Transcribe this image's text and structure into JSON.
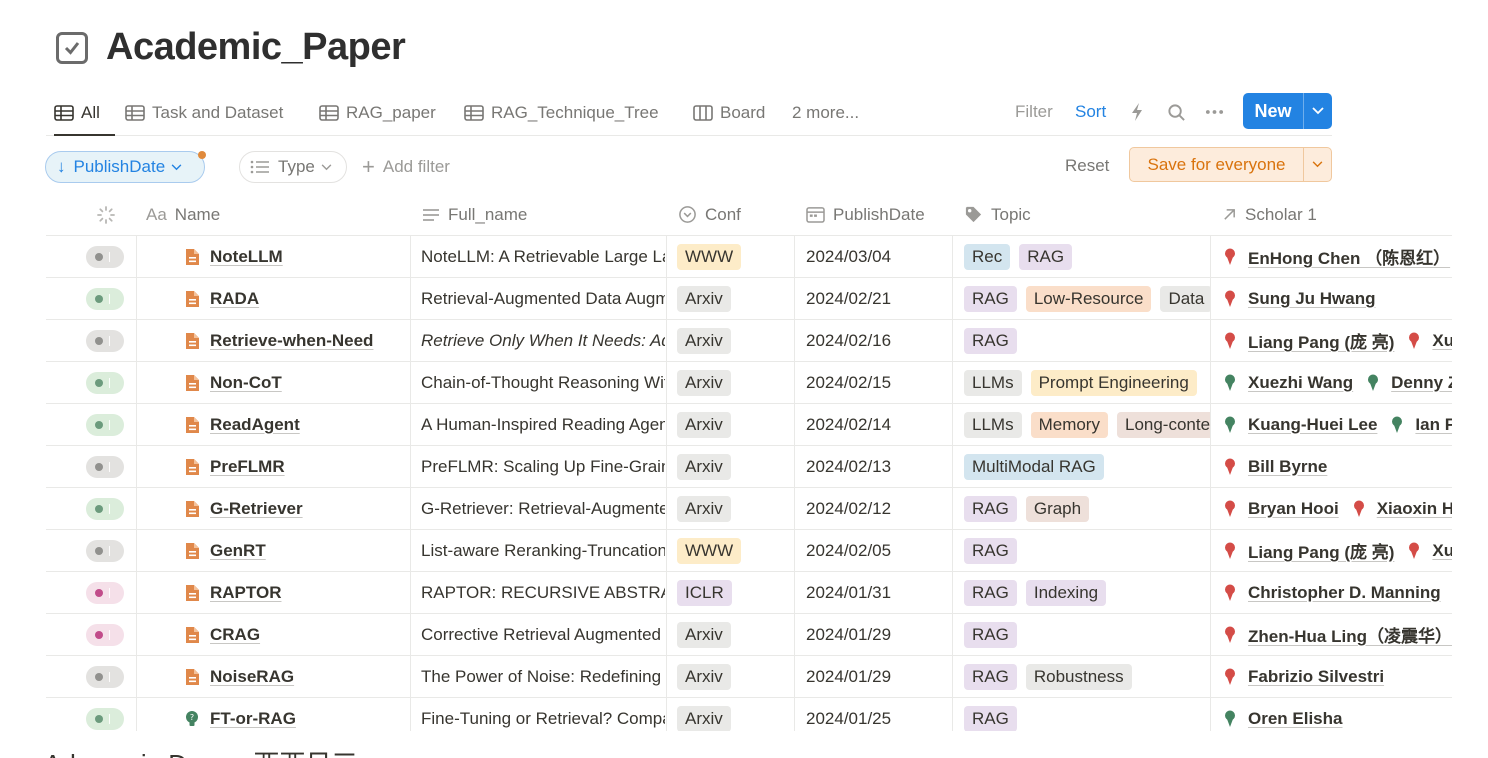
{
  "page": {
    "title": "Academic_Paper",
    "footer_fragment": "Adaomaia Damar 西西日三"
  },
  "views": {
    "tabs": [
      {
        "label": "All",
        "active": true,
        "icon": "table-icon"
      },
      {
        "label": "Task and Dataset",
        "icon": "table-icon"
      },
      {
        "label": "RAG_paper",
        "icon": "table-icon"
      },
      {
        "label": "RAG_Technique_Tree",
        "icon": "table-icon"
      },
      {
        "label": "Board",
        "icon": "board-icon"
      }
    ],
    "more_label": "2 more...",
    "filter_label": "Filter",
    "sort_label": "Sort",
    "new_label": "New"
  },
  "filters": {
    "sort_pill": "PublishDate",
    "type_pill": "Type",
    "add_filter": "Add filter",
    "reset": "Reset",
    "save": "Save for everyone"
  },
  "columns": {
    "name": "Name",
    "name_prefix": "Aa",
    "full_name": "Full_name",
    "conf": "Conf",
    "publish_date": "PublishDate",
    "topic": "Topic",
    "scholar": "Scholar 1"
  },
  "colors": {
    "accent": "#2383e2",
    "status_gray": "#e3e2e0",
    "status_green": "#dbeddb",
    "status_pink": "#f5e0e9",
    "tag_gray": "#e9e9e7",
    "tag_yellow": "#fdecc8",
    "tag_orange": "#fadec9",
    "tag_purple": "#e8deee",
    "tag_blue": "#d3e5ef",
    "tag_brown": "#eee0da",
    "pin_red": "#d44c47",
    "pin_green": "#448361"
  },
  "rows": [
    {
      "status": "gray",
      "icon": "doc",
      "name": "NoteLLM",
      "full": "NoteLLM: A Retrievable Large Language Model",
      "full_italic": false,
      "conf": {
        "label": "WWW",
        "color": "yellow"
      },
      "date": "2024/03/04",
      "topics": [
        {
          "label": "Rec",
          "color": "blue"
        },
        {
          "label": "RAG",
          "color": "purple"
        }
      ],
      "scholars": [
        {
          "name": "EnHong Chen （陈恩红）",
          "pin": "red"
        }
      ]
    },
    {
      "status": "green",
      "icon": "doc",
      "name": "RADA",
      "full": "Retrieval-Augmented Data Augmentation",
      "full_italic": false,
      "conf": {
        "label": "Arxiv",
        "color": "gray"
      },
      "date": "2024/02/21",
      "topics": [
        {
          "label": "RAG",
          "color": "purple"
        },
        {
          "label": "Low-Resource",
          "color": "orange"
        },
        {
          "label": "Data",
          "color": "gray"
        }
      ],
      "scholars": [
        {
          "name": "Sung Ju Hwang",
          "pin": "red"
        }
      ]
    },
    {
      "status": "gray",
      "icon": "doc",
      "name": "Retrieve-when-Need",
      "full": "Retrieve Only When It Needs: Adaptive Retrieval",
      "full_italic": true,
      "conf": {
        "label": "Arxiv",
        "color": "gray"
      },
      "date": "2024/02/16",
      "topics": [
        {
          "label": "RAG",
          "color": "purple"
        }
      ],
      "scholars": [
        {
          "name": "Liang Pang (庞 亮)",
          "pin": "red"
        },
        {
          "name": "Xueqi",
          "pin": "red"
        }
      ]
    },
    {
      "status": "green",
      "icon": "doc",
      "name": "Non-CoT",
      "full": "Chain-of-Thought Reasoning Without Prompting",
      "full_italic": false,
      "conf": {
        "label": "Arxiv",
        "color": "gray"
      },
      "date": "2024/02/15",
      "topics": [
        {
          "label": "LLMs",
          "color": "gray"
        },
        {
          "label": "Prompt Engineering",
          "color": "yellow"
        }
      ],
      "scholars": [
        {
          "name": "Xuezhi Wang",
          "pin": "green"
        },
        {
          "name": "Denny Zhou",
          "pin": "green"
        }
      ]
    },
    {
      "status": "green",
      "icon": "doc",
      "name": "ReadAgent",
      "full": "A Human-Inspired Reading Agent",
      "full_italic": false,
      "conf": {
        "label": "Arxiv",
        "color": "gray"
      },
      "date": "2024/02/14",
      "topics": [
        {
          "label": "LLMs",
          "color": "gray"
        },
        {
          "label": "Memory",
          "color": "orange"
        },
        {
          "label": "Long-context",
          "color": "brown"
        }
      ],
      "scholars": [
        {
          "name": "Kuang-Huei Lee",
          "pin": "green"
        },
        {
          "name": "Ian Fischer",
          "pin": "green"
        }
      ]
    },
    {
      "status": "gray",
      "icon": "doc",
      "name": "PreFLMR",
      "full": "PreFLMR: Scaling Up Fine-Grained Late-Interaction",
      "full_italic": false,
      "conf": {
        "label": "Arxiv",
        "color": "gray"
      },
      "date": "2024/02/13",
      "topics": [
        {
          "label": "MultiModal RAG",
          "color": "blue"
        }
      ],
      "scholars": [
        {
          "name": "Bill Byrne",
          "pin": "red"
        }
      ]
    },
    {
      "status": "green",
      "icon": "doc",
      "name": "G-Retriever",
      "full": "G-Retriever: Retrieval-Augmented Generation",
      "full_italic": false,
      "conf": {
        "label": "Arxiv",
        "color": "gray"
      },
      "date": "2024/02/12",
      "topics": [
        {
          "label": "RAG",
          "color": "purple"
        },
        {
          "label": "Graph",
          "color": "brown"
        }
      ],
      "scholars": [
        {
          "name": "Bryan Hooi",
          "pin": "red"
        },
        {
          "name": "Xiaoxin He",
          "pin": "red"
        }
      ]
    },
    {
      "status": "gray",
      "icon": "doc",
      "name": "GenRT",
      "full": "List-aware Reranking-Truncation Joint Model",
      "full_italic": false,
      "conf": {
        "label": "WWW",
        "color": "yellow"
      },
      "date": "2024/02/05",
      "topics": [
        {
          "label": "RAG",
          "color": "purple"
        }
      ],
      "scholars": [
        {
          "name": "Liang Pang (庞 亮)",
          "pin": "red"
        },
        {
          "name": "Xueqi",
          "pin": "red"
        }
      ]
    },
    {
      "status": "pink",
      "icon": "doc",
      "name": "RAPTOR",
      "full": "RAPTOR: RECURSIVE ABSTRACTIVE PROCESSING",
      "full_italic": false,
      "conf": {
        "label": "ICLR",
        "color": "purple"
      },
      "date": "2024/01/31",
      "topics": [
        {
          "label": "RAG",
          "color": "purple"
        },
        {
          "label": "Indexing",
          "color": "purple"
        }
      ],
      "scholars": [
        {
          "name": "Christopher D. Manning",
          "pin": "red"
        }
      ]
    },
    {
      "status": "pink",
      "icon": "doc",
      "name": "CRAG",
      "full": "Corrective Retrieval Augmented Generation",
      "full_italic": false,
      "conf": {
        "label": "Arxiv",
        "color": "gray"
      },
      "date": "2024/01/29",
      "topics": [
        {
          "label": "RAG",
          "color": "purple"
        }
      ],
      "scholars": [
        {
          "name": "Zhen-Hua Ling（凌震华）",
          "pin": "red"
        }
      ]
    },
    {
      "status": "gray",
      "icon": "doc",
      "name": "NoiseRAG",
      "full": "The Power of Noise: Redefining Retrieval",
      "full_italic": false,
      "conf": {
        "label": "Arxiv",
        "color": "gray"
      },
      "date": "2024/01/29",
      "topics": [
        {
          "label": "RAG",
          "color": "purple"
        },
        {
          "label": "Robustness",
          "color": "gray"
        }
      ],
      "scholars": [
        {
          "name": "Fabrizio Silvestri",
          "pin": "red"
        }
      ]
    },
    {
      "status": "green",
      "icon": "bulb",
      "name": "FT-or-RAG",
      "full": "Fine-Tuning or Retrieval? Comparing Knowledge",
      "full_italic": false,
      "conf": {
        "label": "Arxiv",
        "color": "gray"
      },
      "date": "2024/01/25",
      "topics": [
        {
          "label": "RAG",
          "color": "purple"
        }
      ],
      "scholars": [
        {
          "name": "Oren Elisha",
          "pin": "green"
        }
      ]
    }
  ]
}
